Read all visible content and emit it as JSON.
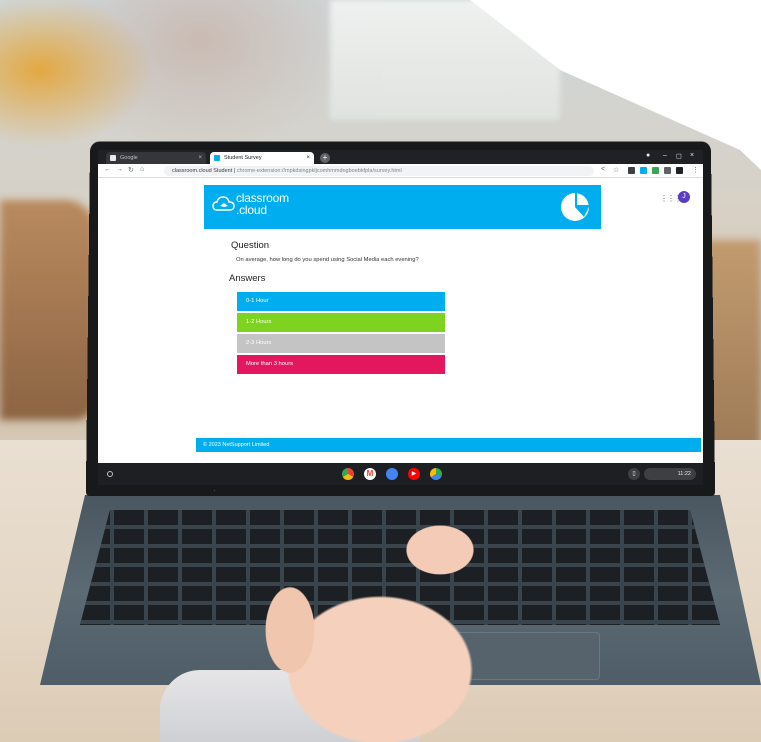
{
  "browser": {
    "tabs": [
      {
        "label": "Google",
        "active": false
      },
      {
        "label": "Student Survey",
        "active": true
      }
    ],
    "address_prefix": "classroom.cloud Student",
    "address_url": "chrome-extension://mpkdsingpkljcomhmmdngboebkfpla/survey.html",
    "avatar_letter": "J"
  },
  "page": {
    "logo_line1": "classroom",
    "logo_line2": ".cloud",
    "question_heading": "Question",
    "question_text": "On average, how long do you spend using Social Media each evening?",
    "answers_heading": "Answers",
    "answers": [
      {
        "label": "0-1 Hour",
        "color": "#00aeef"
      },
      {
        "label": "1-2 Hours",
        "color": "#7ed321"
      },
      {
        "label": "2-3 Hours",
        "color": "#c4c4c4"
      },
      {
        "label": "More than 3 hours",
        "color": "#e2175e"
      }
    ],
    "footer": "© 2023 NetSupport Limited"
  },
  "shelf": {
    "apps": [
      "chrome-icon",
      "gmail-icon",
      "docs-icon",
      "youtube-icon",
      "play-store-icon"
    ],
    "time": "11:22"
  },
  "colors": {
    "brand": "#00aeef"
  }
}
